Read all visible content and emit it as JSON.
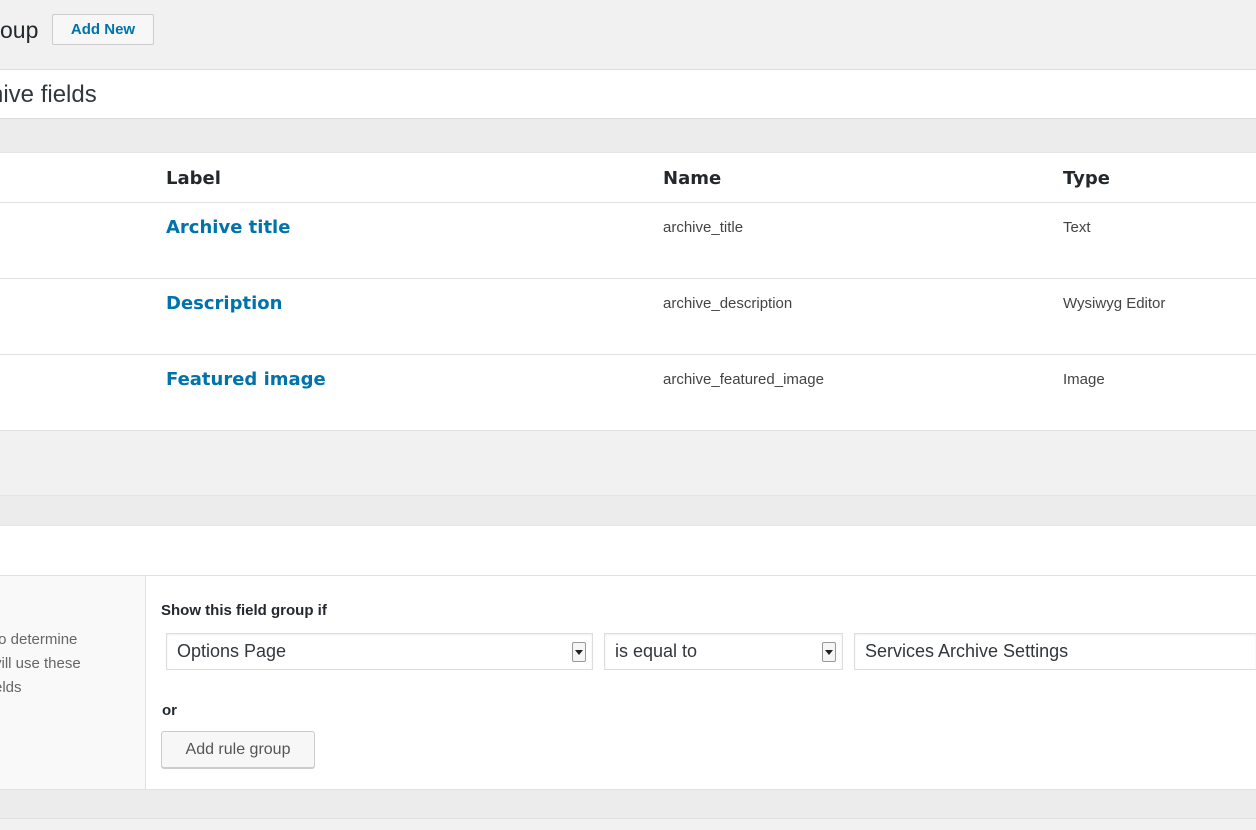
{
  "header": {
    "title": "oup",
    "add_new_label": "Add New"
  },
  "title_input": {
    "value": "hive fields"
  },
  "fields_table": {
    "columns": [
      "Label",
      "Name",
      "Type"
    ],
    "rows": [
      {
        "label": "Archive title",
        "name": "archive_title",
        "type": "Text"
      },
      {
        "label": "Description",
        "name": "archive_description",
        "type": "Wysiwyg Editor"
      },
      {
        "label": "Featured image",
        "name": "archive_featured_image",
        "type": "Image"
      }
    ]
  },
  "location": {
    "description_lines": [
      " to determine",
      "vill use these",
      "elds"
    ],
    "show_if_label": "Show this field group if",
    "rule": {
      "param": "Options Page",
      "operator": "is equal to",
      "value": "Services Archive Settings"
    },
    "or_label": "or",
    "add_rule_group_label": "Add rule group"
  }
}
